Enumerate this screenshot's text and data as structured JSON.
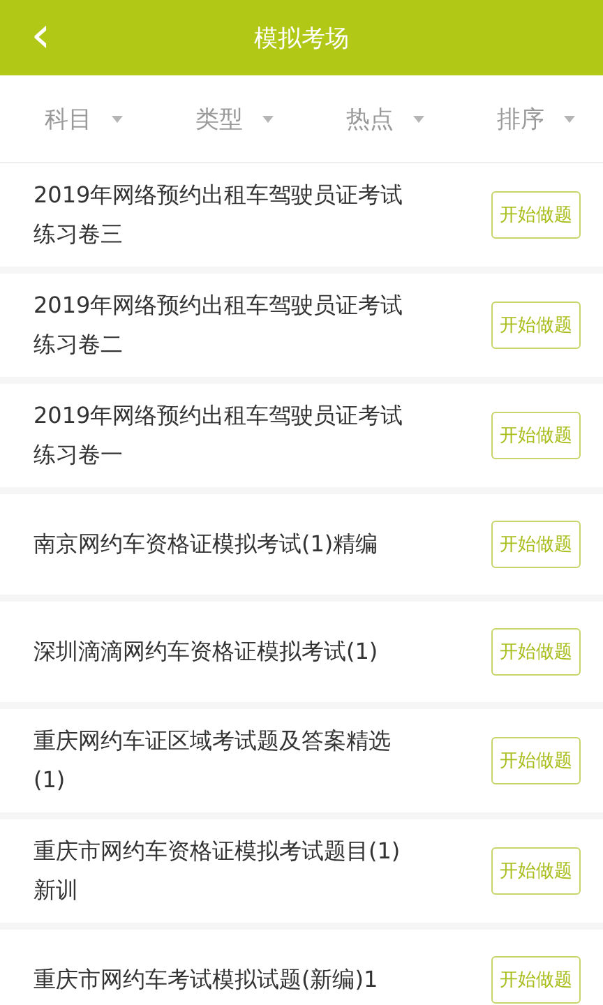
{
  "header": {
    "back_icon": "‹",
    "title": "模拟考场"
  },
  "filters": [
    {
      "label": "科目"
    },
    {
      "label": "类型"
    },
    {
      "label": "热点"
    },
    {
      "label": "排序"
    }
  ],
  "exams": [
    {
      "title": "2019年网络预约出租车驾驶员证考试练习卷三",
      "button": "开始做题"
    },
    {
      "title": "2019年网络预约出租车驾驶员证考试练习卷二",
      "button": "开始做题"
    },
    {
      "title": "2019年网络预约出租车驾驶员证考试练习卷一",
      "button": "开始做题"
    },
    {
      "title": "南京网约车资格证模拟考试(1)精编",
      "button": "开始做题"
    },
    {
      "title": "深圳滴滴网约车资格证模拟考试(1)",
      "button": "开始做题"
    },
    {
      "title": "重庆网约车证区域考试题及答案精选(1)",
      "button": "开始做题"
    },
    {
      "title": "重庆市网约车资格证模拟考试题目(1)新训",
      "button": "开始做题"
    },
    {
      "title": "重庆市网约车考试模拟试题(新编)1",
      "button": "开始做题"
    }
  ]
}
